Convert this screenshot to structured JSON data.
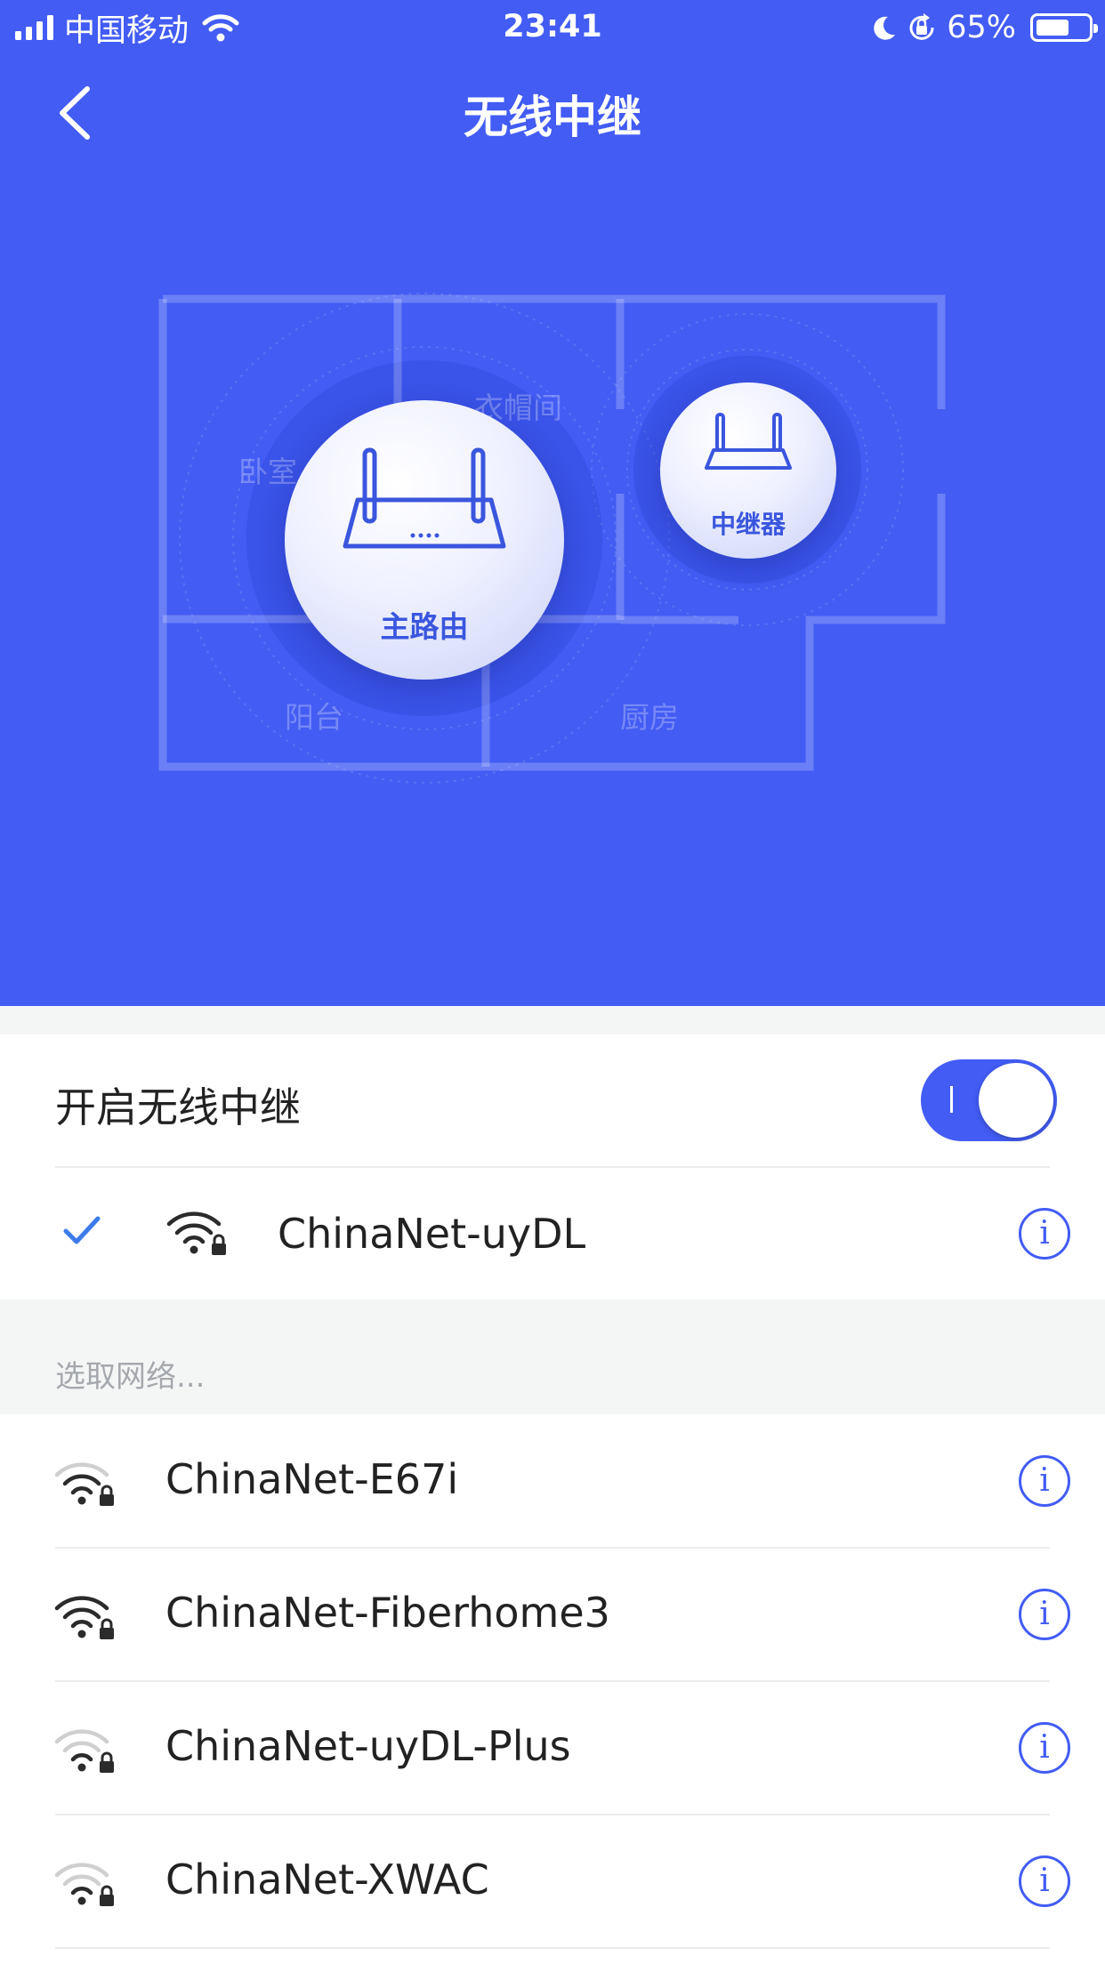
{
  "status_bar": {
    "carrier": "中国移动",
    "time": "23:41",
    "battery_percent": "65%",
    "battery_level": 0.65
  },
  "nav": {
    "title": "无线中继",
    "back_icon": "chevron-left-icon"
  },
  "floorplan": {
    "rooms": {
      "bedroom": "卧室",
      "closet": "衣帽间",
      "balcony": "阳台",
      "kitchen": "厨房"
    },
    "main_router_label": "主路由",
    "repeater_label": "中继器"
  },
  "relay": {
    "toggle_label": "开启无线中继",
    "enabled": true,
    "connected_network": "ChinaNet-uyDL"
  },
  "networks": {
    "section_label": "选取网络...",
    "items": [
      {
        "ssid": "ChinaNet-E67i"
      },
      {
        "ssid": "ChinaNet-Fiberhome3"
      },
      {
        "ssid": "ChinaNet-uyDL-Plus"
      },
      {
        "ssid": "ChinaNet-XWAC"
      }
    ],
    "info_glyph": "i"
  },
  "colors": {
    "accent": "#425cf4",
    "background": "#f4f6f6"
  }
}
